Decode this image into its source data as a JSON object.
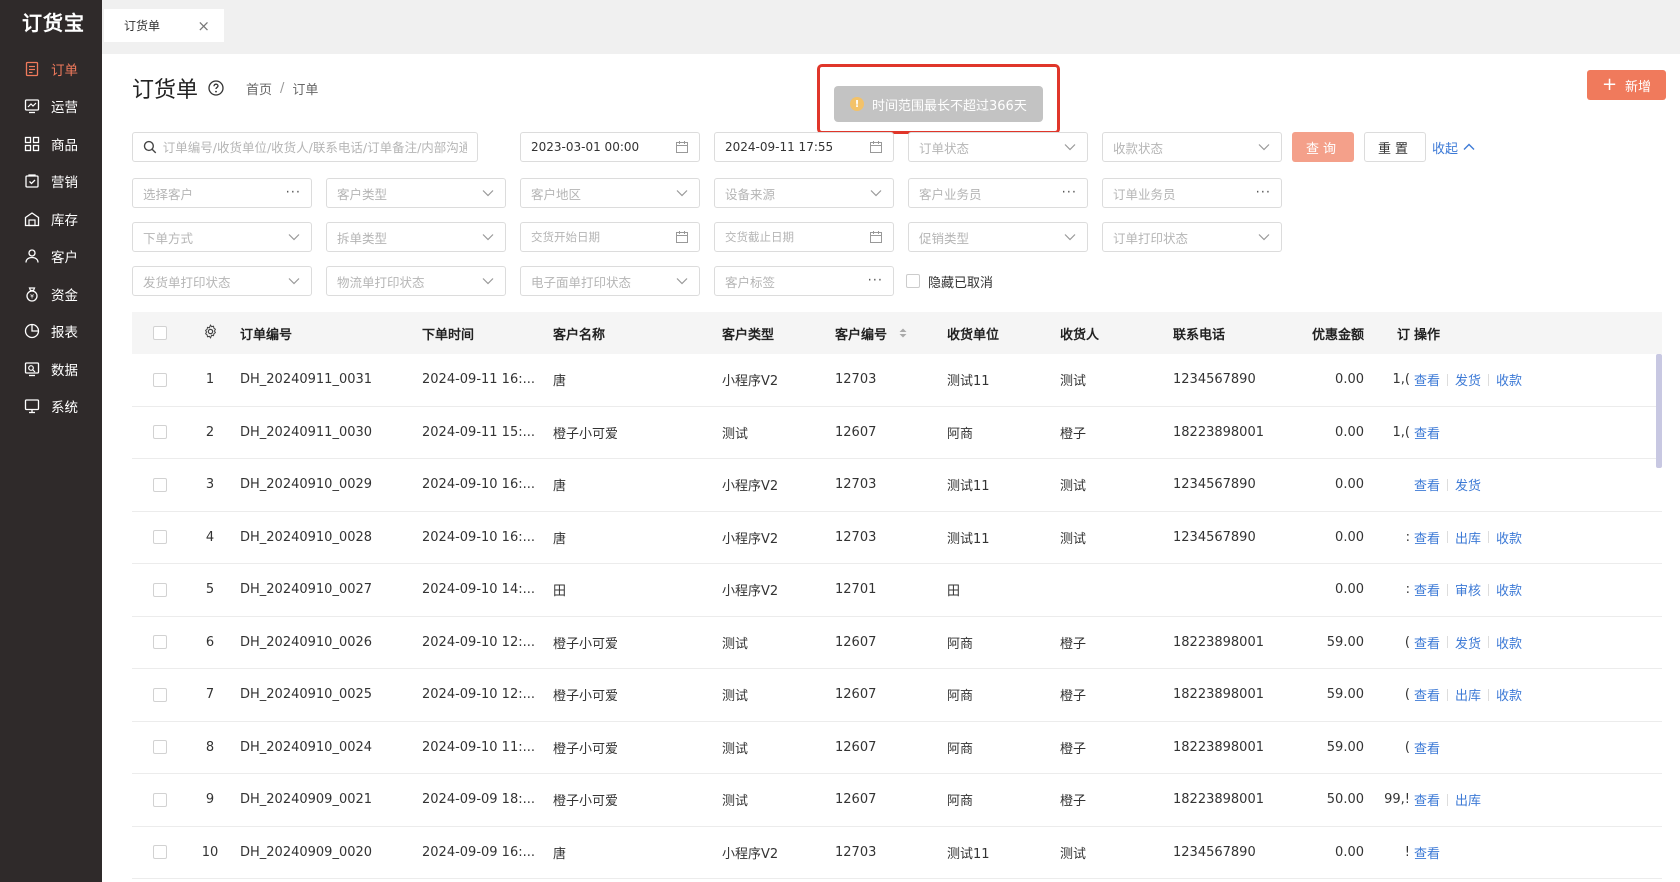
{
  "app": {
    "logo": "订货宝"
  },
  "sidebar": {
    "items": [
      {
        "label": "订单",
        "icon": "order-icon",
        "active": true
      },
      {
        "label": "运营",
        "icon": "operation-icon"
      },
      {
        "label": "商品",
        "icon": "goods-icon"
      },
      {
        "label": "营销",
        "icon": "marketing-icon"
      },
      {
        "label": "库存",
        "icon": "warehouse-icon"
      },
      {
        "label": "客户",
        "icon": "customer-icon"
      },
      {
        "label": "资金",
        "icon": "money-bag-icon"
      },
      {
        "label": "报表",
        "icon": "report-icon"
      },
      {
        "label": "数据",
        "icon": "data-icon"
      },
      {
        "label": "系统",
        "icon": "monitor-icon"
      }
    ]
  },
  "tabs": [
    {
      "label": "订货单",
      "close": "×"
    }
  ],
  "header": {
    "title": "订货单",
    "breadcrumb": [
      "首页",
      "订单"
    ],
    "add_label": "新增"
  },
  "toast": {
    "message": "时间范围最长不超过366天"
  },
  "filters": {
    "search_placeholder": "订单编号/收货单位/收货人/联系电话/订单备注/内部沟通",
    "date_start": "2023-03-01 00:00",
    "date_end": "2024-09-11 17:55",
    "order_status": "订单状态",
    "payment_status": "收款状态",
    "query_label": "查询",
    "reset_label": "重置",
    "collapse_label": "收起",
    "select_customer": "选择客户",
    "customer_type": "客户类型",
    "customer_region": "客户地区",
    "device_source": "设备来源",
    "customer_salesman": "客户业务员",
    "order_salesman": "订单业务员",
    "order_method": "下单方式",
    "split_type": "拆单类型",
    "delivery_start": "交货开始日期",
    "delivery_end": "交货截止日期",
    "promo_type": "促销类型",
    "order_print_status": "订单打印状态",
    "ship_print_status": "发货单打印状态",
    "logistics_print_status": "物流单打印状态",
    "ewaybill_print_status": "电子面单打印状态",
    "customer_tag": "客户标签",
    "hide_cancelled": "隐藏已取消"
  },
  "table": {
    "columns": {
      "no": "订单编号",
      "time": "下单时间",
      "customer": "客户名称",
      "ctype": "客户类型",
      "cno": "客户编号",
      "unit": "收货单位",
      "receiver": "收货人",
      "phone": "联系电话",
      "discount": "优惠金额",
      "order_amount": "订",
      "ops": "操作"
    },
    "rows": [
      {
        "idx": "1",
        "no": "DH_20240911_0031",
        "time": "2024-09-11 16:...",
        "customer": "唐",
        "ctype": "小程序V2",
        "cno": "12703",
        "unit": "测试11",
        "receiver": "测试",
        "phone": "1234567890",
        "discount": "0.00",
        "order_amount": "1,(",
        "ops": [
          "查看",
          "发货",
          "收款"
        ]
      },
      {
        "idx": "2",
        "no": "DH_20240911_0030",
        "time": "2024-09-11 15:...",
        "customer": "橙子小可爱",
        "ctype": "测试",
        "cno": "12607",
        "unit": "阿商",
        "receiver": "橙子",
        "phone": "18223898001",
        "discount": "0.00",
        "order_amount": "1,(",
        "ops": [
          "查看"
        ]
      },
      {
        "idx": "3",
        "no": "DH_20240910_0029",
        "time": "2024-09-10 16:...",
        "customer": "唐",
        "ctype": "小程序V2",
        "cno": "12703",
        "unit": "测试11",
        "receiver": "测试",
        "phone": "1234567890",
        "discount": "0.00",
        "order_amount": "",
        "ops": [
          "查看",
          "发货"
        ]
      },
      {
        "idx": "4",
        "no": "DH_20240910_0028",
        "time": "2024-09-10 16:...",
        "customer": "唐",
        "ctype": "小程序V2",
        "cno": "12703",
        "unit": "测试11",
        "receiver": "测试",
        "phone": "1234567890",
        "discount": "0.00",
        "order_amount": ":",
        "ops": [
          "查看",
          "出库",
          "收款"
        ]
      },
      {
        "idx": "5",
        "no": "DH_20240910_0027",
        "time": "2024-09-10 14:...",
        "customer": "田",
        "ctype": "小程序V2",
        "cno": "12701",
        "unit": "田",
        "receiver": "",
        "phone": "",
        "discount": "0.00",
        "order_amount": ":",
        "ops": [
          "查看",
          "审核",
          "收款"
        ]
      },
      {
        "idx": "6",
        "no": "DH_20240910_0026",
        "time": "2024-09-10 12:...",
        "customer": "橙子小可爱",
        "ctype": "测试",
        "cno": "12607",
        "unit": "阿商",
        "receiver": "橙子",
        "phone": "18223898001",
        "discount": "59.00",
        "order_amount": "(",
        "ops": [
          "查看",
          "发货",
          "收款"
        ]
      },
      {
        "idx": "7",
        "no": "DH_20240910_0025",
        "time": "2024-09-10 12:...",
        "customer": "橙子小可爱",
        "ctype": "测试",
        "cno": "12607",
        "unit": "阿商",
        "receiver": "橙子",
        "phone": "18223898001",
        "discount": "59.00",
        "order_amount": "(",
        "ops": [
          "查看",
          "出库",
          "收款"
        ]
      },
      {
        "idx": "8",
        "no": "DH_20240910_0024",
        "time": "2024-09-10 11:...",
        "customer": "橙子小可爱",
        "ctype": "测试",
        "cno": "12607",
        "unit": "阿商",
        "receiver": "橙子",
        "phone": "18223898001",
        "discount": "59.00",
        "order_amount": "(",
        "ops": [
          "查看"
        ]
      },
      {
        "idx": "9",
        "no": "DH_20240909_0021",
        "time": "2024-09-09 18:...",
        "customer": "橙子小可爱",
        "ctype": "测试",
        "cno": "12607",
        "unit": "阿商",
        "receiver": "橙子",
        "phone": "18223898001",
        "discount": "50.00",
        "order_amount": "99,!",
        "ops": [
          "查看",
          "出库"
        ]
      },
      {
        "idx": "10",
        "no": "DH_20240909_0020",
        "time": "2024-09-09 16:...",
        "customer": "唐",
        "ctype": "小程序V2",
        "cno": "12703",
        "unit": "测试11",
        "receiver": "测试",
        "phone": "1234567890",
        "discount": "0.00",
        "order_amount": "!",
        "ops": [
          "查看"
        ]
      }
    ]
  },
  "colors": {
    "accent": "#f07a5c",
    "link": "#3d7ad6",
    "sidebar_bg": "#2f2a2a"
  }
}
